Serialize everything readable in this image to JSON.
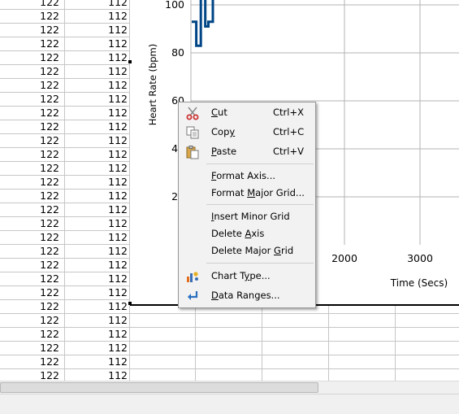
{
  "sheet": {
    "col_a_value": "122",
    "col_b_value": "112",
    "partial_b_value": "112",
    "row_count": 28
  },
  "chart": {
    "ylabel": "Heart Rate (bpm)",
    "xlabel": "Time (Secs)",
    "yticks": [
      "100",
      "80",
      "60",
      "40",
      "20"
    ],
    "xticks": [
      "2000",
      "3000"
    ],
    "series_color": "#004586"
  },
  "chart_data": {
    "type": "line",
    "title": "",
    "xlabel": "Time (Secs)",
    "ylabel": "Heart Rate (bpm)",
    "x_ticks": [
      2000,
      3000
    ],
    "y_ticks": [
      20,
      40,
      60,
      80,
      100
    ],
    "series": [
      {
        "x": [
          0,
          60,
          60,
          120,
          120,
          180,
          180,
          220,
          220,
          280,
          280,
          320
        ],
        "values": [
          93,
          93,
          83,
          83,
          103,
          103,
          91,
          91,
          93,
          93,
          105,
          105
        ]
      }
    ],
    "grid": true,
    "legend": "none"
  },
  "context_menu": {
    "items": [
      {
        "key": "cut",
        "pre": "",
        "u": "C",
        "post": "ut",
        "accel": "Ctrl+X",
        "icon": "scissors-icon"
      },
      {
        "key": "copy",
        "pre": "Cop",
        "u": "y",
        "post": "",
        "accel": "Ctrl+C",
        "icon": "copy-icon"
      },
      {
        "key": "paste",
        "pre": "",
        "u": "P",
        "post": "aste",
        "accel": "Ctrl+V",
        "icon": "paste-icon"
      },
      {
        "key": "format-axis",
        "pre": "",
        "u": "F",
        "post": "ormat Axis...",
        "accel": "",
        "icon": ""
      },
      {
        "key": "format-major-grid",
        "pre": "Format ",
        "u": "M",
        "post": "ajor Grid...",
        "accel": "",
        "icon": ""
      },
      {
        "key": "insert-minor-grid",
        "pre": "",
        "u": "I",
        "post": "nsert Minor Grid",
        "accel": "",
        "icon": ""
      },
      {
        "key": "delete-axis",
        "pre": "Delete ",
        "u": "A",
        "post": "xis",
        "accel": "",
        "icon": ""
      },
      {
        "key": "delete-major-grid",
        "pre": "Delete Major ",
        "u": "G",
        "post": "rid",
        "accel": "",
        "icon": ""
      },
      {
        "key": "chart-type",
        "pre": "Chart T",
        "u": "y",
        "post": "pe...",
        "accel": "",
        "icon": "chart-type-icon"
      },
      {
        "key": "data-ranges",
        "pre": "",
        "u": "D",
        "post": "ata Ranges...",
        "accel": "",
        "icon": "data-ranges-icon"
      }
    ]
  }
}
